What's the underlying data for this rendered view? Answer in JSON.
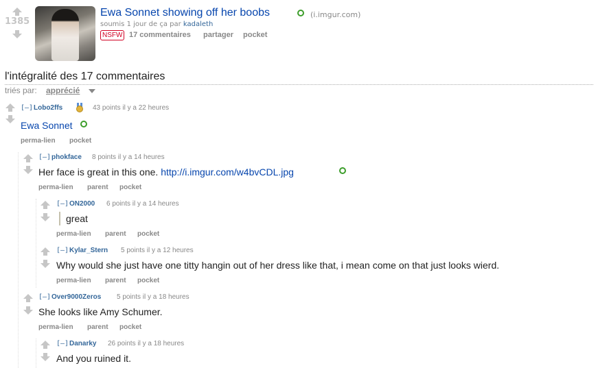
{
  "post": {
    "score": "1385",
    "title": "Ewa Sonnet showing off her boobs",
    "domain": "(i.imgur.com)",
    "submitted_prefix": "soumis 1 jour de ça par ",
    "author": "kadaleth",
    "nsfw": "NSFW",
    "comments_link": "17 commentaires",
    "share_link": "partager",
    "pocket_link": "pocket"
  },
  "section": {
    "title": "l'intégralité des 17 commentaires",
    "sort_label": "triés par:",
    "sort_value": "apprécié"
  },
  "comments": [
    {
      "toggle": "[–]",
      "author": "Lobo2ffs",
      "meta": "43 points il y a 22 heures",
      "body": "Ewa Sonnet",
      "actions": [
        "perma-lien",
        "pocket"
      ]
    },
    {
      "toggle": "[–]",
      "author": "phokface",
      "meta": "8 points il y a 14 heures",
      "body": "Her face is great in this one. ",
      "link": "http://i.imgur.com/w4bvCDL.jpg",
      "actions": [
        "perma-lien",
        "parent",
        "pocket"
      ]
    },
    {
      "toggle": "[–]",
      "author": "ON2000",
      "meta": "6 points il y a 14 heures",
      "body": "great",
      "actions": [
        "perma-lien",
        "parent",
        "pocket"
      ]
    },
    {
      "toggle": "[–]",
      "author": "Kylar_Stern",
      "meta": "5 points il y a 12 heures",
      "body": "Why would she just have one titty hangin out of her dress like that, i mean come on that just looks wierd.",
      "actions": [
        "perma-lien",
        "parent",
        "pocket"
      ]
    },
    {
      "toggle": "[–]",
      "author": "Over9000Zeros",
      "meta": "5 points il y a 18 heures",
      "body": "She looks like Amy Schumer.",
      "actions": [
        "perma-lien",
        "parent",
        "pocket"
      ]
    },
    {
      "toggle": "[–]",
      "author": "Danarky",
      "meta": "26 points il y a 18 heures",
      "body": "And you ruined it.",
      "actions": []
    }
  ],
  "colors": {
    "link": "#0645ad",
    "author": "#336699",
    "nsfw": "#d10023",
    "muted": "#888888",
    "green": "#3c9d2a"
  }
}
